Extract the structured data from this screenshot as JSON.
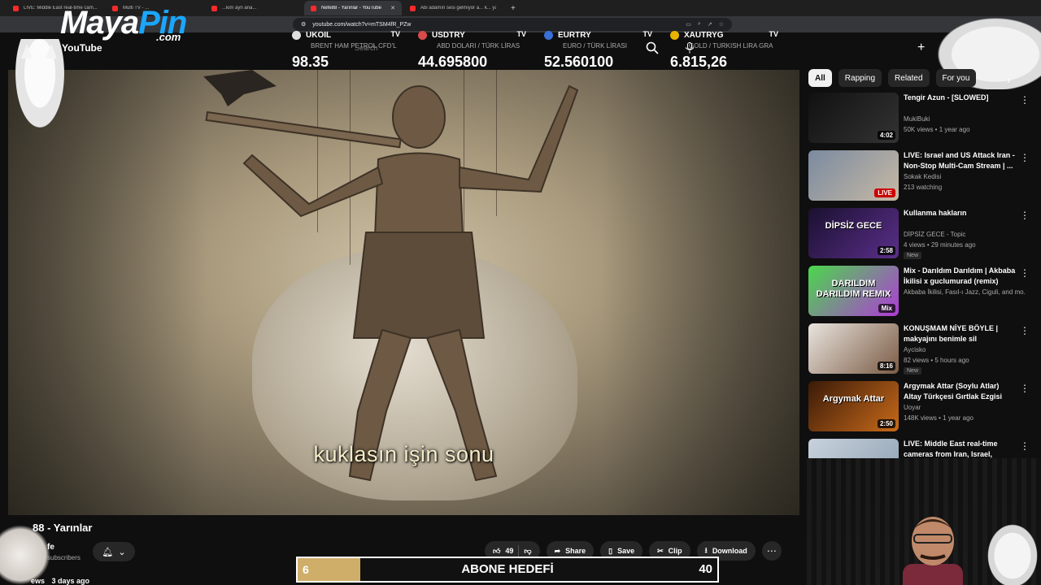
{
  "browser": {
    "tabs": [
      {
        "label": "LIVE: Middle East real-time cam...",
        "active": false
      },
      {
        "label": "Multi TV - ...",
        "active": false
      },
      {
        "label": "...kim ayn ana...",
        "active": false
      },
      {
        "label": "Nefe88 - Yarınlar - YouTube",
        "active": true,
        "close": "✕"
      },
      {
        "label": "Abi adamın sesi gelmiyor a... k... ya...",
        "active": false
      }
    ],
    "new_tab": "+",
    "url": "youtube.com/watch?v=mTSM4fR_PZw"
  },
  "overlay": {
    "logo_main": "Maya",
    "logo_accent": "Pin",
    "logo_domain": ".com",
    "youtube_label": "YouTube"
  },
  "ticker": [
    {
      "symbol": "UKOIL",
      "desc": "BRENT HAM PETROL CFD'L",
      "value": "98.35",
      "color": "#e0e0e0"
    },
    {
      "symbol": "USDTRY",
      "desc": "ABD DOLARI / TÜRK LİRAS",
      "value": "44.695800",
      "color": "#d94a4a"
    },
    {
      "symbol": "EURTRY",
      "desc": "EURO / TÜRK LİRASI",
      "value": "52.560100",
      "color": "#3a6fd8"
    },
    {
      "symbol": "XAUTRYG",
      "desc": "GOLD / TURKISH LIRA GRA",
      "value": "6.815,26",
      "color": "#e8b400"
    }
  ],
  "ticker_brand": "TV",
  "search_placeholder": "Search",
  "video": {
    "subtitle": "kuklasın işin sonu",
    "title": "88 - Yarınlar",
    "channel": "fe",
    "subscribers": "subscribers",
    "views": "ews",
    "age": "3 days ago"
  },
  "actions": {
    "likes": "49",
    "share": "Share",
    "save": "Save",
    "clip": "Clip",
    "download": "Download"
  },
  "goal": {
    "current": "6",
    "label": "ABONE HEDEFİ",
    "target": "40",
    "progress": 0.15
  },
  "chips": [
    "All",
    "Rapping",
    "Related",
    "For you"
  ],
  "recommendations": [
    {
      "title": "Tengir Azun - [SLOWED]",
      "channel": "MukiBuki",
      "meta": "50K views • 1 year ago",
      "duration": "4:02",
      "badge": "",
      "colors": [
        "#111",
        "#333"
      ]
    },
    {
      "title": "LIVE: Israel and US Attack Iran - Non-Stop Multi-Cam Stream | ...",
      "channel": "Sokak Kedisi",
      "meta": "213 watching",
      "duration": "",
      "badge": "LIVE",
      "colors": [
        "#7a8aa0",
        "#c7b9a4"
      ]
    },
    {
      "title": "Kullanma hakların",
      "channel": "DİPSİZ GECE - Topic",
      "meta": "4 views • 29 minutes ago",
      "duration": "2:58",
      "badge": "New",
      "thumb_text": "DİPSİZ GECE",
      "colors": [
        "#1a1030",
        "#5b2f8a"
      ]
    },
    {
      "title": "Mix - Darıldım Darıldım | Akbaba İkilisi x guclumurad (remix)",
      "channel": "Akbaba İkilisi, Fasıl-ı Jazz, Ciguli, and mo...",
      "meta": "",
      "duration": "",
      "badge": "Mix",
      "thumb_text": "DARILDIM DARILDIM REMIX",
      "colors": [
        "#4ad84a",
        "#b03ad8"
      ]
    },
    {
      "title": "KONUŞMAM NİYE BÖYLE | makyajını benimle sil",
      "channel": "Aycisko",
      "meta": "82 views • 5 hours ago",
      "duration": "8:16",
      "badge": "New",
      "colors": [
        "#e9e4de",
        "#7b5b45"
      ]
    },
    {
      "title": "Argymak Attar (Soylu Atlar) Altay Türkçesi Gırtlak Ezgisi",
      "channel": "Uoyar",
      "meta": "148K views • 1 year ago",
      "duration": "2:50",
      "badge": "",
      "thumb_text": "Argymak Attar",
      "colors": [
        "#3a1a08",
        "#c86a1a"
      ]
    },
    {
      "title": "LIVE: Middle East real-time cameras from Iran, Israel, Qata...",
      "channel": "",
      "meta": "",
      "duration": "",
      "badge": "",
      "colors": [
        "#c8d2dc",
        "#8ea0b2"
      ]
    }
  ]
}
